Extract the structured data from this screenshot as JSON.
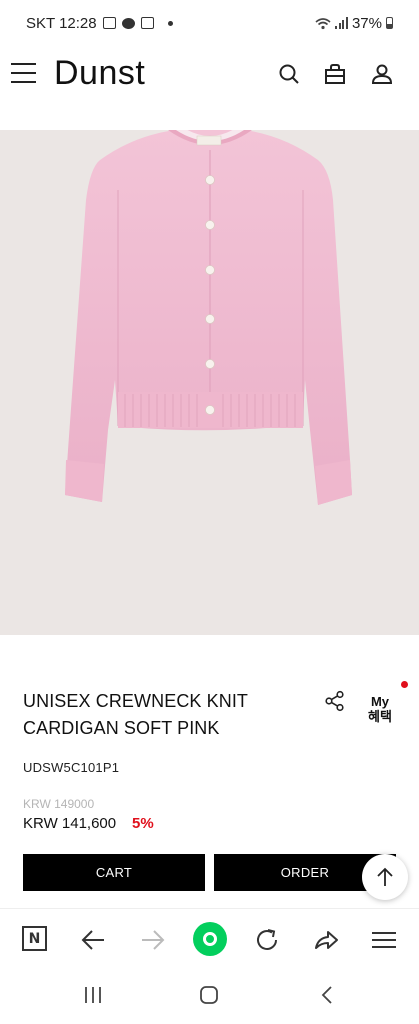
{
  "status_bar": {
    "carrier_time": "SKT 12:28",
    "battery": "37%"
  },
  "header": {
    "logo": "Dunst",
    "icons": [
      "menu-icon",
      "search-icon",
      "shopping-bag-icon",
      "user-icon"
    ]
  },
  "product": {
    "image_alt": "pink cardigan",
    "title": "UNISEX CREWNECK KNIT CARDIGAN SOFT PINK",
    "code": "UDSW5C101P1",
    "original_price": "KRW 149000",
    "sale_price": "KRW 141,600",
    "discount": "5%",
    "my_benefit": "My\n혜택"
  },
  "actions": {
    "cart_label": "CART",
    "order_label": "ORDER"
  },
  "browser_toolbar": {
    "icons": [
      "naver-home-icon",
      "back-arrow-icon",
      "forward-arrow-icon",
      "green-dot-icon",
      "refresh-icon",
      "share-arrow-icon",
      "hamburger-menu-icon"
    ]
  },
  "system_nav": {
    "icons": [
      "recent-apps-icon",
      "home-icon",
      "back-icon"
    ]
  },
  "colors": {
    "accent_red": "#e0101c",
    "naver_green": "#03cf5d",
    "cardigan_pink": "#f0bcd2",
    "image_bg": "#ebe6e4"
  }
}
